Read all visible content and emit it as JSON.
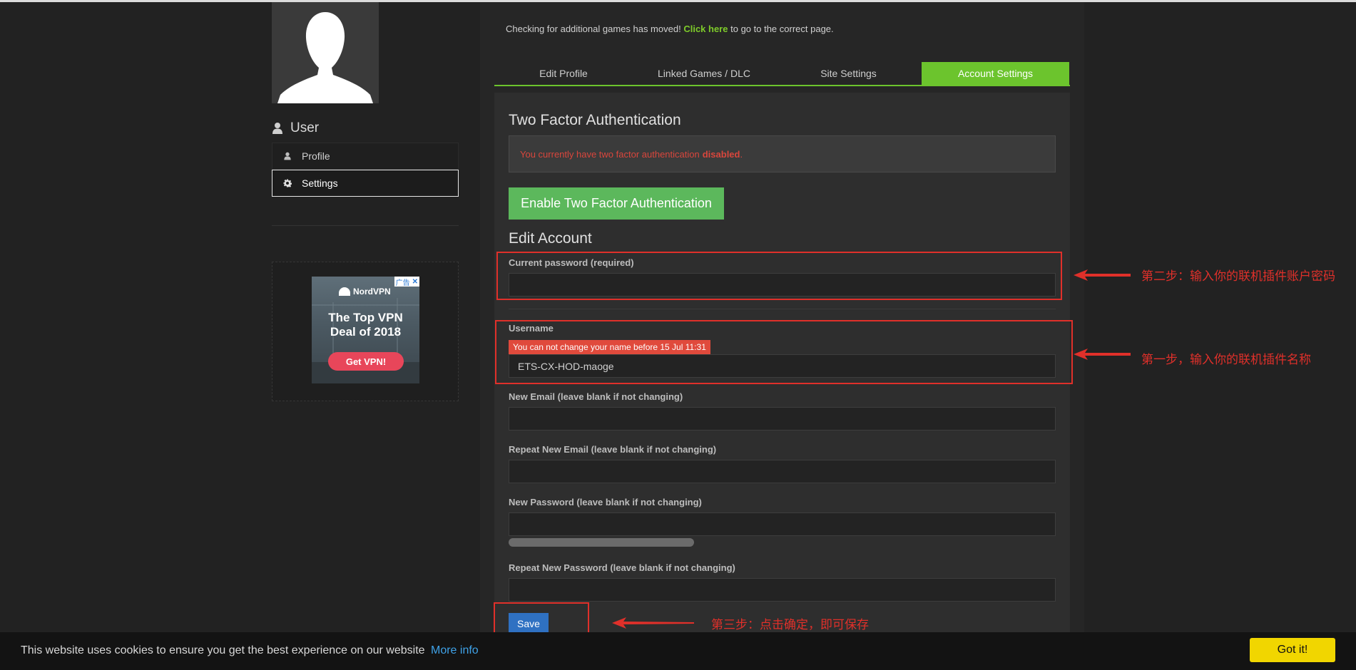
{
  "sidebar": {
    "section_title": "User",
    "items": [
      {
        "label": "Profile",
        "icon": "user-icon",
        "active": false
      },
      {
        "label": "Settings",
        "icon": "gear-icon",
        "active": true
      }
    ]
  },
  "ad": {
    "badge": "广告",
    "brand": "NordVPN",
    "headline_line1": "The Top VPN",
    "headline_line2": "Deal of 2018",
    "cta": "Get VPN!"
  },
  "notice": {
    "prefix": "Checking for additional games has moved!",
    "link": "Click here",
    "suffix": "to go to the correct page."
  },
  "tabs": [
    {
      "label": "Edit Profile",
      "active": false
    },
    {
      "label": "Linked Games / DLC",
      "active": false
    },
    {
      "label": "Site Settings",
      "active": false
    },
    {
      "label": "Account Settings",
      "active": true
    }
  ],
  "two_factor": {
    "title": "Two Factor Authentication",
    "status_text": "You currently have two factor authentication",
    "status_value": "disabled",
    "status_end": ".",
    "enable_button": "Enable Two Factor Authentication"
  },
  "edit_account": {
    "title": "Edit Account",
    "current_password_label": "Current password (required)",
    "current_password_value": "",
    "username_label": "Username",
    "username_warning": "You can not change your name before 15 Jul 11:31",
    "username_value": "ETS-CX-HOD-maoge",
    "new_email_label": "New Email (leave blank if not changing)",
    "repeat_email_label": "Repeat New Email (leave blank if not changing)",
    "new_password_label": "New Password (leave blank if not changing)",
    "repeat_password_label": "Repeat New Password (leave blank if not changing)",
    "save_button": "Save"
  },
  "annotations": {
    "step2": "第二步：输入你的联机插件账户密码",
    "step1": "第一步，输入你的联机插件名称",
    "step3": "第三步：点击确定，即可保存"
  },
  "cookie": {
    "text": "This website uses cookies to ensure you get the best experience on our website",
    "link": "More info",
    "button": "Got it!"
  },
  "colors": {
    "accent_green": "#6cc42d",
    "alert_red": "#d9463c",
    "annotation_red": "#e0302a",
    "save_blue": "#2f71c2",
    "cookie_yellow": "#f1d600"
  }
}
